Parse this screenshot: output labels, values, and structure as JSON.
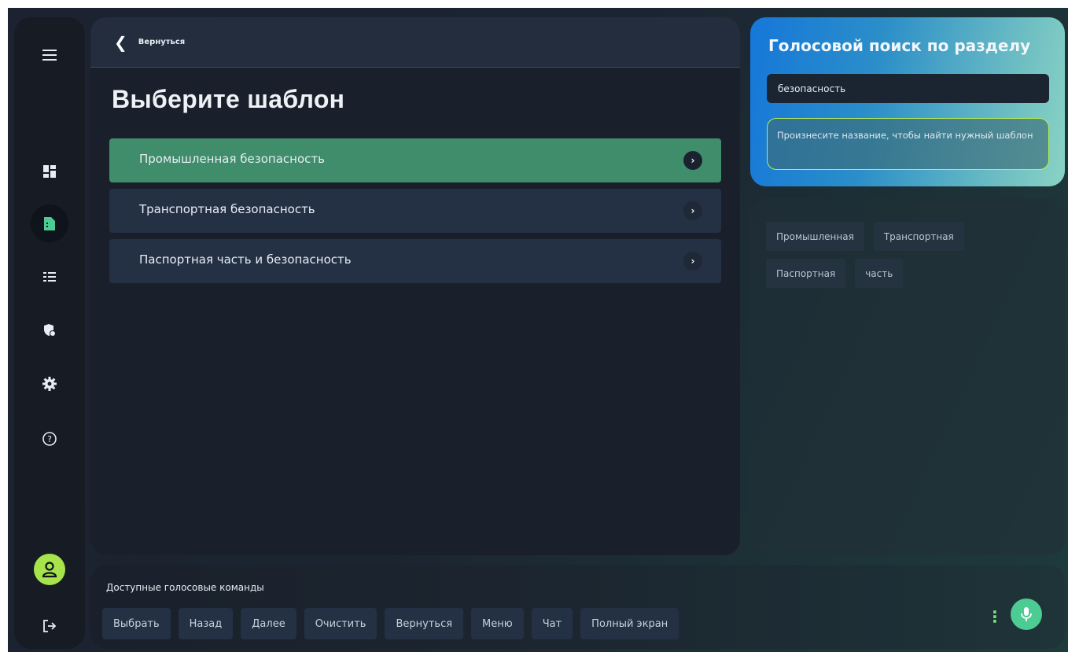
{
  "sidebar": {
    "items": [
      {
        "name": "menu",
        "icon": "hamburger-icon"
      },
      {
        "name": "dashboard",
        "icon": "dashboard-icon"
      },
      {
        "name": "documents",
        "icon": "document-icon",
        "active": true
      },
      {
        "name": "checklist",
        "icon": "checklist-icon"
      },
      {
        "name": "security",
        "icon": "shield-icon"
      },
      {
        "name": "settings",
        "icon": "gear-icon"
      },
      {
        "name": "help",
        "icon": "help-icon"
      },
      {
        "name": "profile",
        "icon": "user-icon"
      },
      {
        "name": "logout",
        "icon": "logout-icon"
      }
    ]
  },
  "header": {
    "back_label": "Вернуться"
  },
  "main": {
    "title": "Выберите шаблон",
    "templates": [
      {
        "label": "Промышленная безопасность",
        "selected": true
      },
      {
        "label": "Транспортная безопасность",
        "selected": false
      },
      {
        "label": "Паспортная часть и безопасность",
        "selected": false
      }
    ]
  },
  "voice_search": {
    "title": "Голосовой поиск по разделу",
    "query": "безопасность",
    "hint": "Произнесите название, чтобы найти нужный шаблон"
  },
  "suggestions": {
    "chips": [
      "Промышленная",
      "Транспортная",
      "Паспортная",
      "часть"
    ]
  },
  "commands": {
    "title": "Доступные голосовые команды",
    "items": [
      "Выбрать",
      "Назад",
      "Далее",
      "Очистить",
      "Вернуться",
      "Меню",
      "Чат",
      "Полный экран"
    ]
  },
  "colors": {
    "accent_green": "#3f8d6b",
    "lime": "#a7e34a",
    "mic": "#4ccc93",
    "voice_gradient_start": "#1577d9",
    "voice_gradient_end": "#8ad3c4"
  }
}
